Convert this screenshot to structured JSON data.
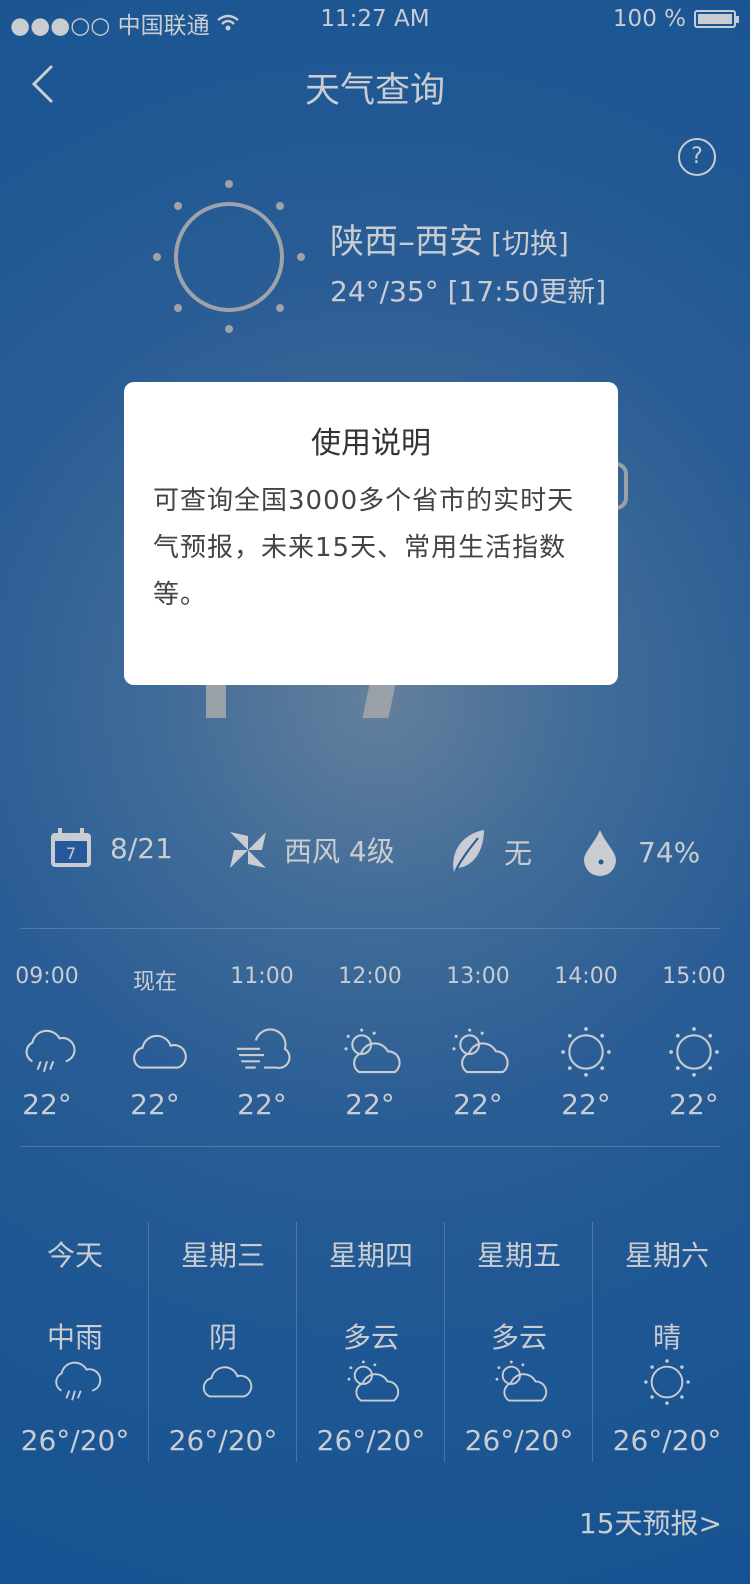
{
  "status_bar": {
    "carrier": "●●●○○ 中国联通",
    "time": "11:27 AM",
    "battery": "100 %"
  },
  "nav": {
    "title": "天气查询",
    "back_icon": "chevron-left-icon",
    "help_icon": "question-circle-icon",
    "help_label": "?"
  },
  "location": {
    "city": "陕西–西安",
    "switch_label": "[切换]",
    "temp_range": "24°/35°",
    "updated": "[17:50更新]"
  },
  "stats": {
    "date": "8/21",
    "wind": "西风 4级",
    "pollution": "无",
    "humidity": "74%"
  },
  "hourly": [
    {
      "time": "09:00",
      "icon": "rain-cloud-icon",
      "temp": "22°"
    },
    {
      "time": "现在",
      "icon": "cloud-icon",
      "temp": "22°"
    },
    {
      "time": "11:00",
      "icon": "wind-cloud-icon",
      "temp": "22°"
    },
    {
      "time": "12:00",
      "icon": "partly-cloudy-icon",
      "temp": "22°"
    },
    {
      "time": "13:00",
      "icon": "partly-cloudy-icon",
      "temp": "22°"
    },
    {
      "time": "14:00",
      "icon": "sun-icon",
      "temp": "22°"
    },
    {
      "time": "15:00",
      "icon": "sun-icon",
      "temp": "22°"
    }
  ],
  "daily": [
    {
      "day": "今天",
      "weather": "中雨",
      "icon": "rain-cloud-icon",
      "temp": "26°/20°"
    },
    {
      "day": "星期三",
      "weather": "阴",
      "icon": "cloud-icon",
      "temp": "26°/20°"
    },
    {
      "day": "星期四",
      "weather": "多云",
      "icon": "partly-cloudy-icon",
      "temp": "26°/20°"
    },
    {
      "day": "星期五",
      "weather": "多云",
      "icon": "partly-cloudy-icon",
      "temp": "26°/20°"
    },
    {
      "day": "星期六",
      "weather": "晴",
      "icon": "sun-icon",
      "temp": "26°/20°"
    }
  ],
  "forecast_link": "15天预报>",
  "modal": {
    "title": "使用说明",
    "body": "可查询全国3000多个省市的实时天气预报，未来15天、常用生活指数等。"
  },
  "colors": {
    "background": "#1e5793",
    "text": "#c9ccd1",
    "modal_bg": "#ffffff",
    "modal_text": "#444444"
  }
}
